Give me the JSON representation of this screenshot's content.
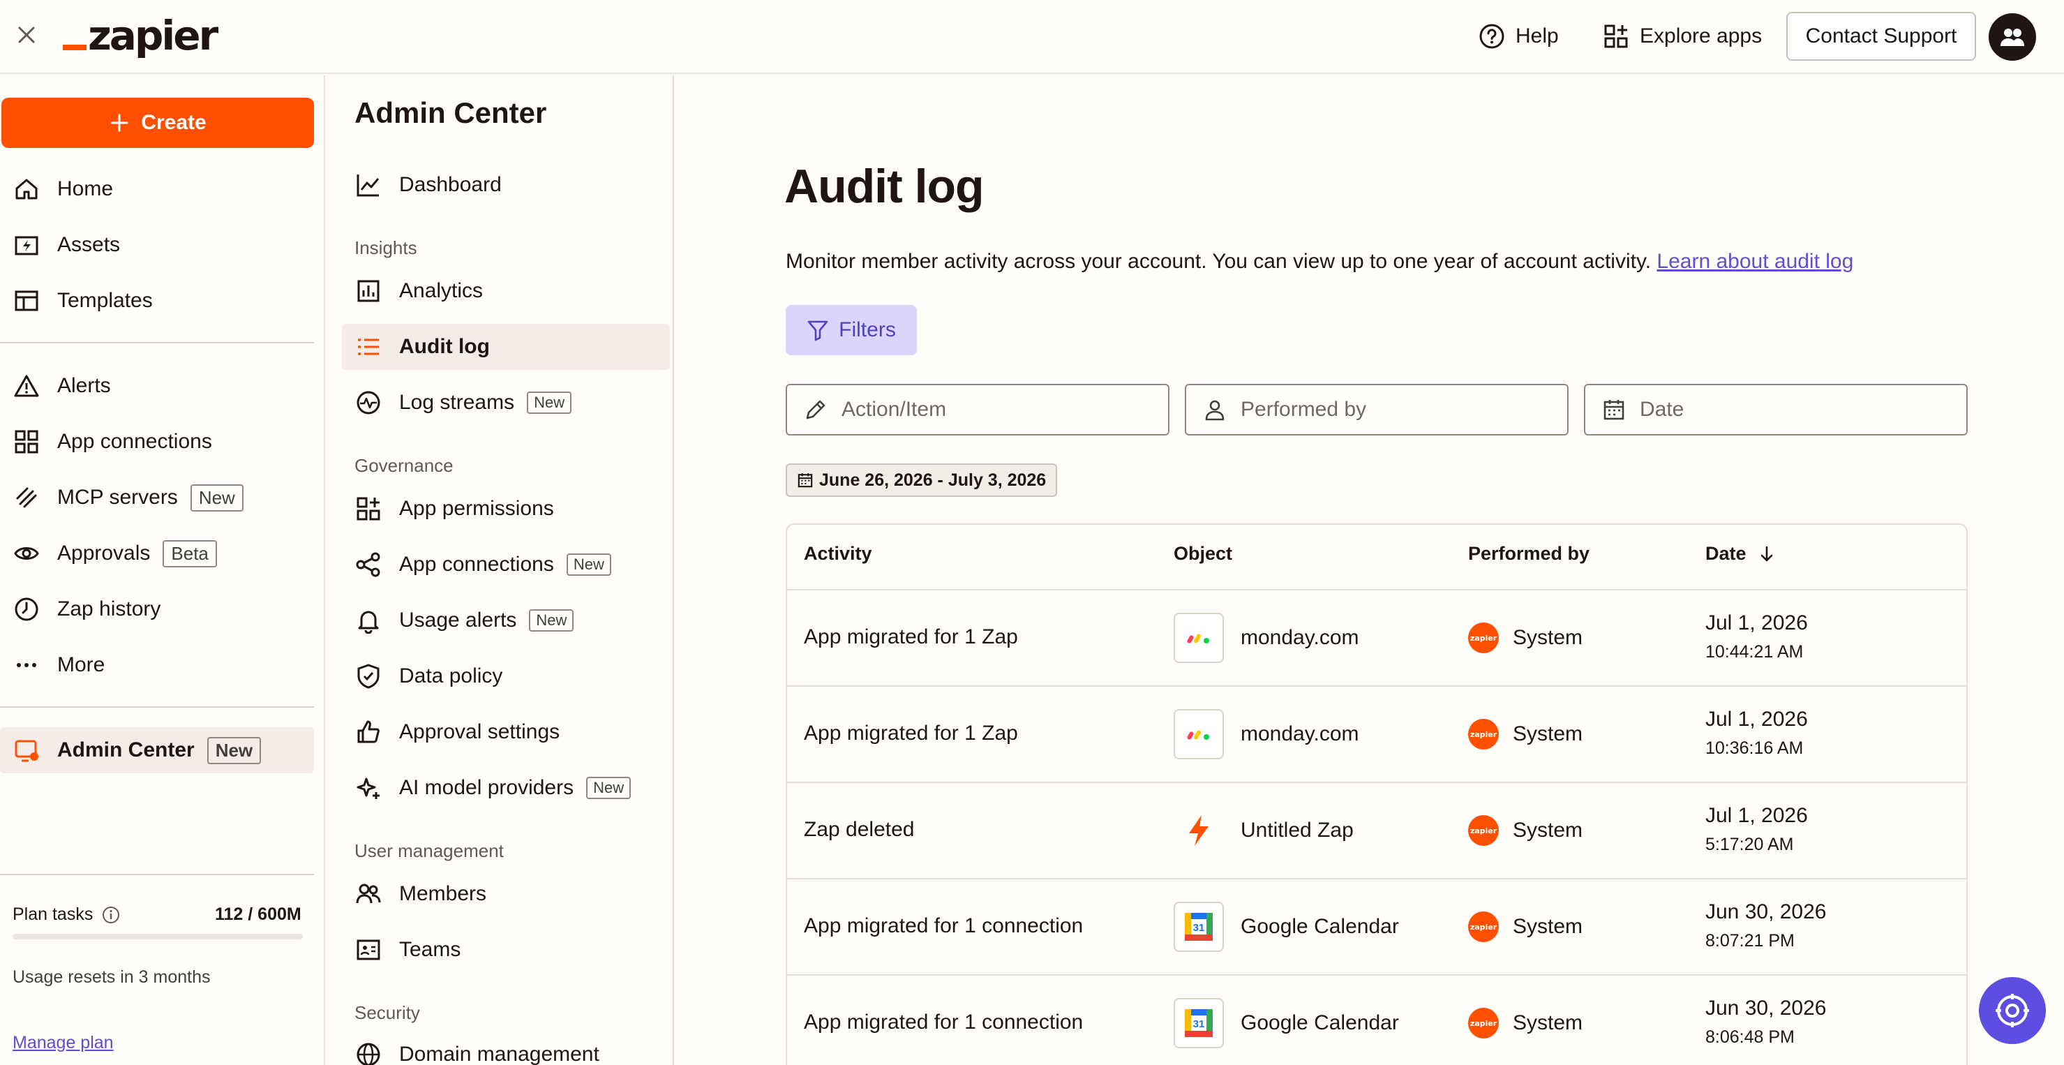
{
  "topbar": {
    "logo_text": "zapier",
    "help_label": "Help",
    "explore_label": "Explore apps",
    "contact_label": "Contact Support"
  },
  "sidebar": {
    "create_label": "Create",
    "items": [
      {
        "label": "Home",
        "icon": "home-icon"
      },
      {
        "label": "Assets",
        "icon": "assets-icon"
      },
      {
        "label": "Templates",
        "icon": "templates-icon"
      },
      {
        "label": "Alerts",
        "icon": "alert-icon"
      },
      {
        "label": "App connections",
        "icon": "app-connections-icon"
      },
      {
        "label": "MCP servers",
        "icon": "mcp-icon",
        "badge": "New"
      },
      {
        "label": "Approvals",
        "icon": "eye-icon",
        "badge": "Beta"
      },
      {
        "label": "Zap history",
        "icon": "history-icon"
      },
      {
        "label": "More",
        "icon": "more-icon"
      },
      {
        "label": "Admin Center",
        "icon": "admin-icon",
        "badge": "New"
      }
    ],
    "plan_tasks_label": "Plan tasks",
    "plan_tasks_value": "112 / 600M",
    "plan_tasks_fraction": 0.0,
    "usage_reset": "Usage resets in 3 months",
    "manage_plan": "Manage plan"
  },
  "admin": {
    "title": "Admin Center",
    "dashboard": "Dashboard",
    "insights_label": "Insights",
    "analytics": "Analytics",
    "audit_log": "Audit log",
    "log_streams": "Log streams",
    "log_streams_badge": "New",
    "governance_label": "Governance",
    "app_permissions": "App permissions",
    "app_connections": "App connections",
    "app_connections_badge": "New",
    "usage_alerts": "Usage alerts",
    "usage_alerts_badge": "New",
    "data_policy": "Data policy",
    "approval_settings": "Approval settings",
    "ai_model_providers": "AI model providers",
    "ai_model_badge": "New",
    "user_mgmt_label": "User management",
    "members": "Members",
    "teams": "Teams",
    "security_label": "Security",
    "domain_management": "Domain management"
  },
  "main": {
    "title": "Audit log",
    "description": "Monitor member activity across your account. You can view up to one year of account activity.",
    "learn_link": "Learn about audit log",
    "filters_label": "Filters",
    "action_placeholder": "Action/Item",
    "performed_placeholder": "Performed by",
    "date_placeholder": "Date",
    "date_range": "June 26, 2026 - July 3, 2026",
    "columns": {
      "activity": "Activity",
      "object": "Object",
      "performed_by": "Performed by",
      "date": "Date"
    },
    "rows": [
      {
        "activity": "App migrated for 1 Zap",
        "object": "monday.com",
        "object_icon": "monday-icon",
        "performed_by": "System",
        "date": "Jul 1, 2026",
        "time": "10:44:21 AM"
      },
      {
        "activity": "App migrated for 1 Zap",
        "object": "monday.com",
        "object_icon": "monday-icon",
        "performed_by": "System",
        "date": "Jul 1, 2026",
        "time": "10:36:16 AM"
      },
      {
        "activity": "Zap deleted",
        "object": "Untitled Zap",
        "object_icon": "zap-bolt-icon",
        "performed_by": "System",
        "date": "Jul 1, 2026",
        "time": "5:17:20 AM"
      },
      {
        "activity": "App migrated for 1 connection",
        "object": "Google Calendar",
        "object_icon": "google-calendar-icon",
        "performed_by": "System",
        "date": "Jun 30, 2026",
        "time": "8:07:21 PM"
      },
      {
        "activity": "App migrated for 1 connection",
        "object": "Google Calendar",
        "object_icon": "google-calendar-icon",
        "performed_by": "System",
        "date": "Jun 30, 2026",
        "time": "8:06:48 PM"
      }
    ],
    "system_icon_text": "zapier",
    "calendar_day": "31"
  },
  "colors": {
    "brand": "#ff4f00",
    "link": "#5f4fcf",
    "filters_bg": "#dcd6ff",
    "assistant": "#5d4de0"
  }
}
